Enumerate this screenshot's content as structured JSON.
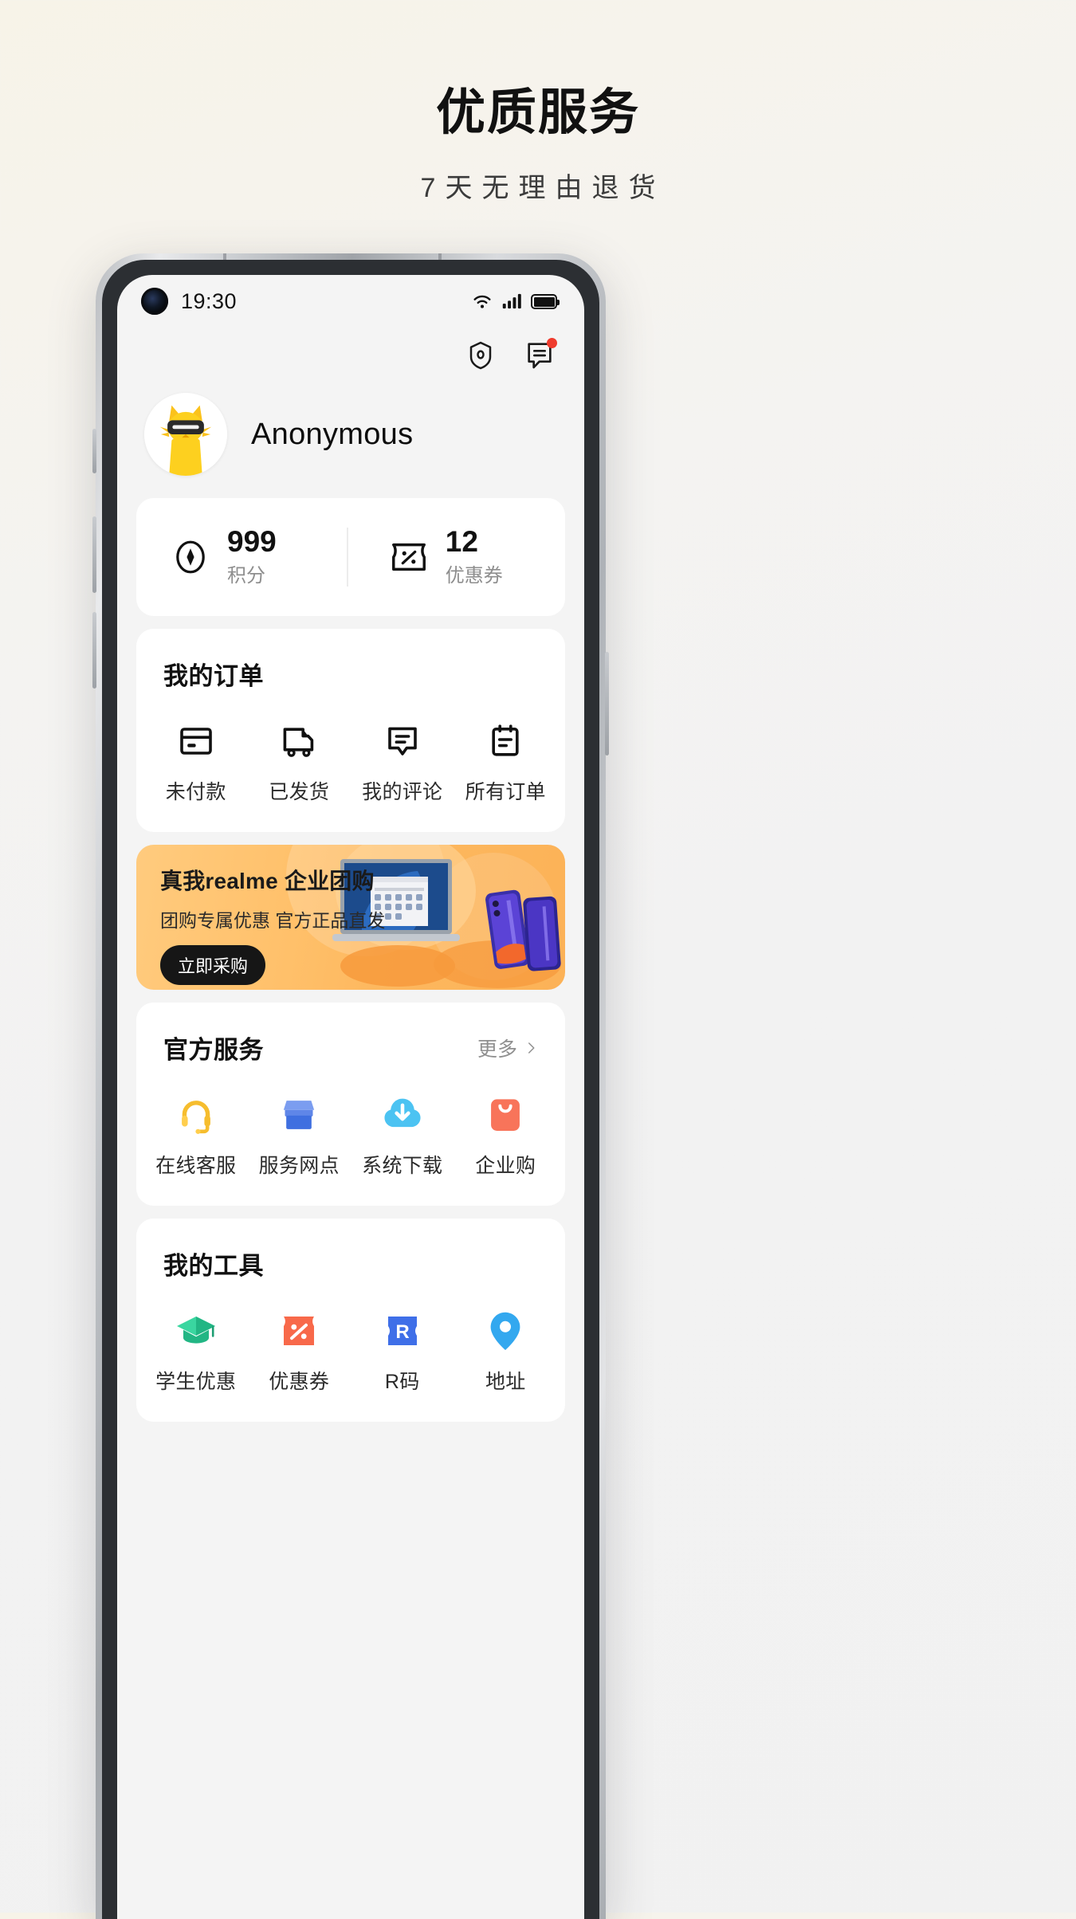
{
  "promo": {
    "title": "优质服务",
    "subtitle": "7天无理由退货"
  },
  "statusbar": {
    "time": "19:30",
    "camera_icon": "punch-hole-camera",
    "wifi_icon": "wifi-icon",
    "signal_icon": "cellular-signal-icon",
    "battery_icon": "battery-icon"
  },
  "header": {
    "scan_icon": "scan-shield-icon",
    "message_icon": "message-icon",
    "message_badge": "",
    "avatar_icon": "cat-avatar",
    "username": "Anonymous"
  },
  "stats": [
    {
      "icon": "points-diamond-icon",
      "value": "999",
      "label": "积分"
    },
    {
      "icon": "coupon-ticket-icon",
      "value": "12",
      "label": "优惠券"
    }
  ],
  "orders": {
    "title": "我的订单",
    "items": [
      {
        "icon": "card-icon",
        "label": "未付款"
      },
      {
        "icon": "truck-icon",
        "label": "已发货"
      },
      {
        "icon": "comment-icon",
        "label": "我的评论"
      },
      {
        "icon": "clipboard-icon",
        "label": "所有订单"
      }
    ]
  },
  "banner": {
    "title": "真我realme 企业团购",
    "subtitle": "团购专属优惠 官方正品直发",
    "button": "立即采购",
    "art_icon": "laptop-and-phone-illustration",
    "bg_color": "#ffc068"
  },
  "services": {
    "title": "官方服务",
    "more_label": "更多",
    "more_icon": "chevron-right-icon",
    "items": [
      {
        "icon": "headset-icon",
        "label": "在线客服",
        "color": "#f8c13c"
      },
      {
        "icon": "store-icon",
        "label": "服务网点",
        "color": "#4a7bdd"
      },
      {
        "icon": "cloud-download-icon",
        "label": "系统下载",
        "color": "#3cb8f0"
      },
      {
        "icon": "shopping-bag-icon",
        "label": "企业购",
        "color": "#f86f4d"
      }
    ]
  },
  "tools": {
    "title": "我的工具",
    "items": [
      {
        "icon": "graduation-cap-icon",
        "label": "学生优惠",
        "color": "#2bc48a"
      },
      {
        "icon": "percent-ticket-icon",
        "label": "优惠券",
        "color": "#f8694a"
      },
      {
        "icon": "r-code-icon",
        "label": "R码",
        "color": "#3f6fe8",
        "glyph": "R"
      },
      {
        "icon": "location-pin-icon",
        "label": "地址",
        "color": "#33a8ef"
      }
    ]
  }
}
